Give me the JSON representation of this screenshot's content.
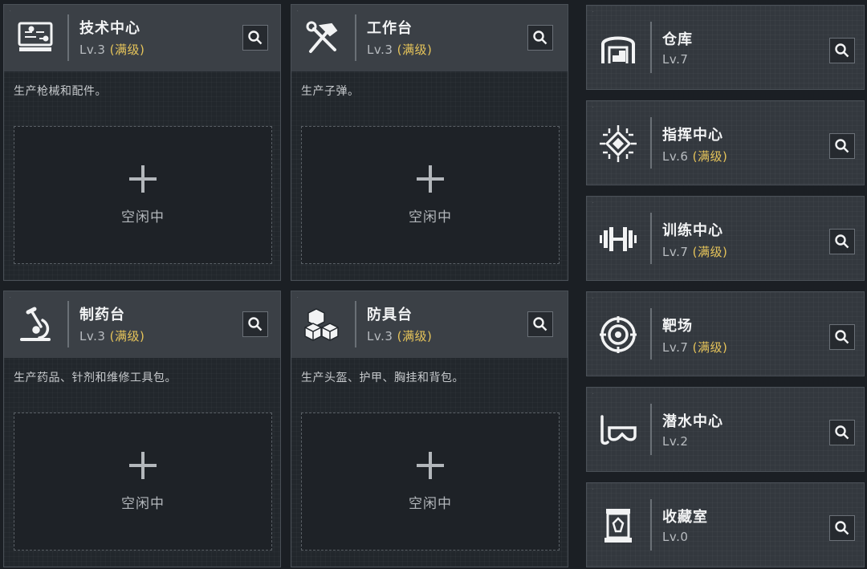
{
  "workshops": [
    {
      "title": "技术中心",
      "level": "Lv.3",
      "max": "(满级)",
      "desc": "生产枪械和配件。",
      "slot_status": "空闲中",
      "icon": "computer-icon"
    },
    {
      "title": "工作台",
      "level": "Lv.3",
      "max": "(满级)",
      "desc": "生产子弹。",
      "slot_status": "空闲中",
      "icon": "hammer-wrench-icon"
    },
    {
      "title": "制药台",
      "level": "Lv.3",
      "max": "(满级)",
      "desc": "生产药品、针剂和维修工具包。",
      "slot_status": "空闲中",
      "icon": "microscope-icon"
    },
    {
      "title": "防具台",
      "level": "Lv.3",
      "max": "(满级)",
      "desc": "生产头盔、护甲、胸挂和背包。",
      "slot_status": "空闲中",
      "icon": "cubes-icon"
    }
  ],
  "facilities": [
    {
      "title": "仓库",
      "level": "Lv.7",
      "max": "",
      "icon": "warehouse-icon"
    },
    {
      "title": "指挥中心",
      "level": "Lv.6",
      "max": "(满级)",
      "icon": "chip-icon"
    },
    {
      "title": "训练中心",
      "level": "Lv.7",
      "max": "(满级)",
      "icon": "dumbbell-icon"
    },
    {
      "title": "靶场",
      "level": "Lv.7",
      "max": "(满级)",
      "icon": "target-icon"
    },
    {
      "title": "潜水中心",
      "level": "Lv.2",
      "max": "",
      "icon": "diving-mask-icon"
    },
    {
      "title": "收藏室",
      "level": "Lv.0",
      "max": "",
      "icon": "display-case-icon"
    }
  ],
  "colors": {
    "accent_max": "#e6c45a",
    "header_bg": "#3b4046",
    "card_bg": "#22272c"
  }
}
